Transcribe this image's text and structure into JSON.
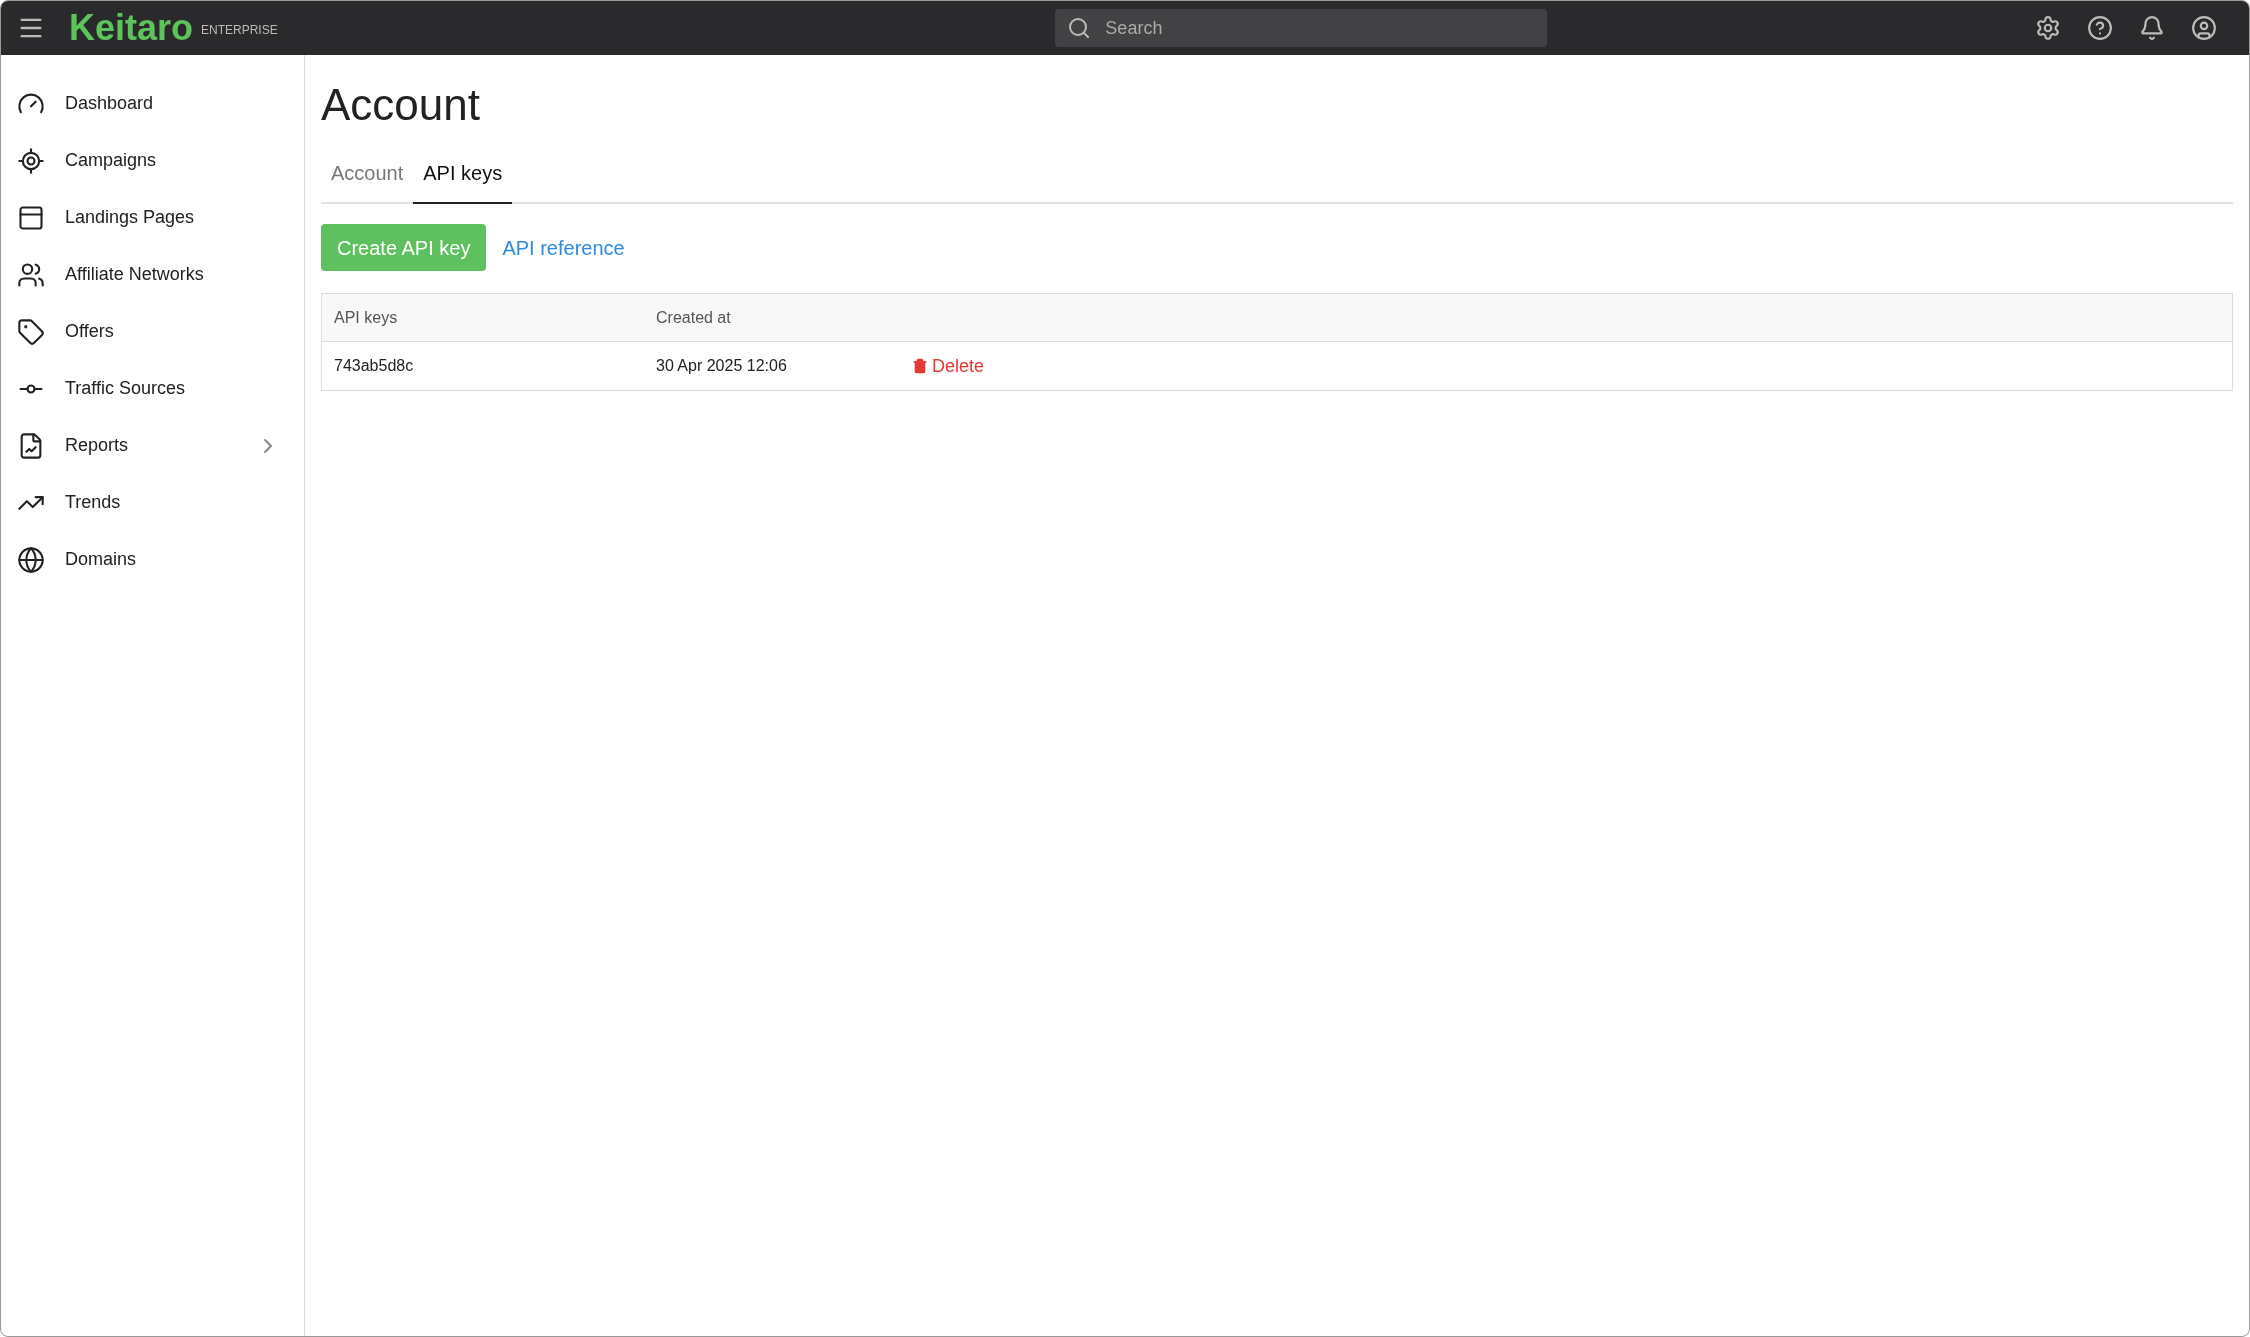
{
  "header": {
    "logo": "Keitaro",
    "edition": "ENTERPRISE",
    "search": {
      "placeholder": "Search"
    }
  },
  "sidebar": {
    "items": [
      {
        "label": "Dashboard",
        "kind": "dashboard",
        "expandable": false
      },
      {
        "label": "Campaigns",
        "kind": "campaigns",
        "expandable": false
      },
      {
        "label": "Landings Pages",
        "kind": "landings",
        "expandable": false
      },
      {
        "label": "Affiliate Networks",
        "kind": "networks",
        "expandable": false
      },
      {
        "label": "Offers",
        "kind": "offers",
        "expandable": false
      },
      {
        "label": "Traffic Sources",
        "kind": "sources",
        "expandable": false
      },
      {
        "label": "Reports",
        "kind": "reports",
        "expandable": true
      },
      {
        "label": "Trends",
        "kind": "trends",
        "expandable": false
      },
      {
        "label": "Domains",
        "kind": "domains",
        "expandable": false
      }
    ]
  },
  "page": {
    "title": "Account",
    "tabs": [
      {
        "label": "Account",
        "selected": false
      },
      {
        "label": "API keys",
        "selected": true
      }
    ],
    "create_button": "Create API key",
    "reference_link": "API reference",
    "table": {
      "columns": [
        "API keys",
        "Created at"
      ],
      "rows": [
        {
          "key": "743ab5d8c",
          "created_at": "30 Apr 2025 12:06",
          "action": "Delete"
        }
      ]
    }
  }
}
